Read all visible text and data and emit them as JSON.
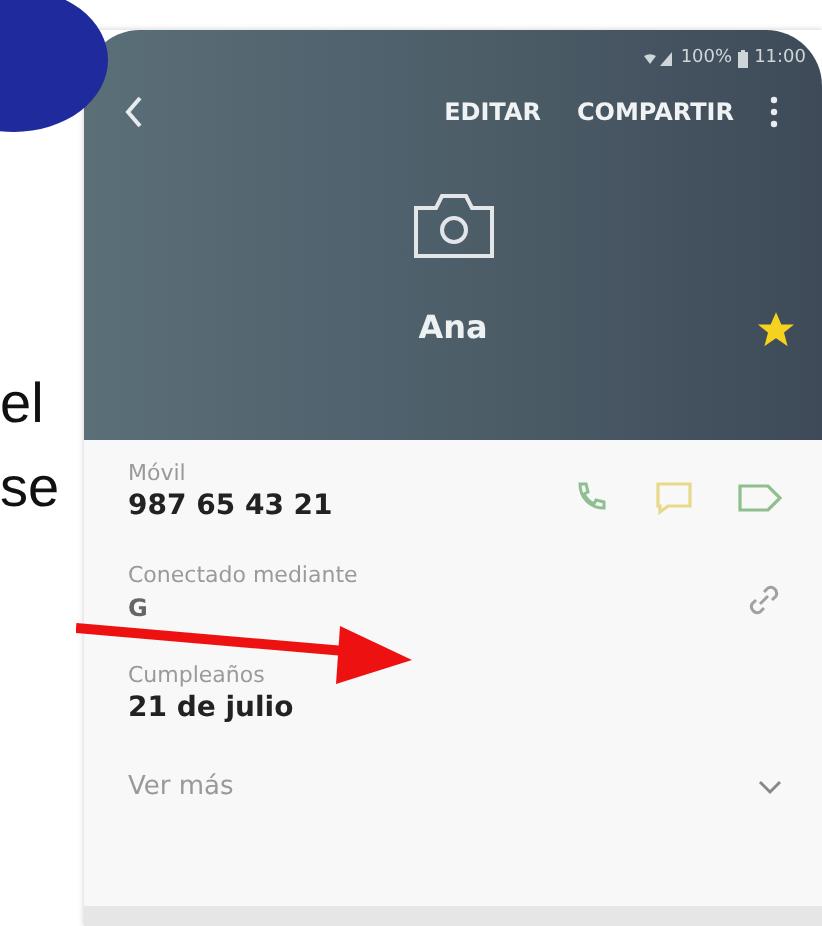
{
  "document_fragments": [
    "el",
    "se"
  ],
  "status_bar": {
    "battery": "100%",
    "time": "11:00"
  },
  "header": {
    "actions": [
      "EDITAR",
      "COMPARTIR"
    ],
    "name": "Ana",
    "favorite": true
  },
  "fields": [
    {
      "kind": "phone",
      "label": "Móvil",
      "value": "987 65 43 21"
    },
    {
      "kind": "linked",
      "label": "Conectado mediante",
      "value": "G"
    },
    {
      "kind": "text",
      "label": "Cumpleaños",
      "value": "21 de julio"
    }
  ],
  "more": {
    "label": "Ver más"
  }
}
